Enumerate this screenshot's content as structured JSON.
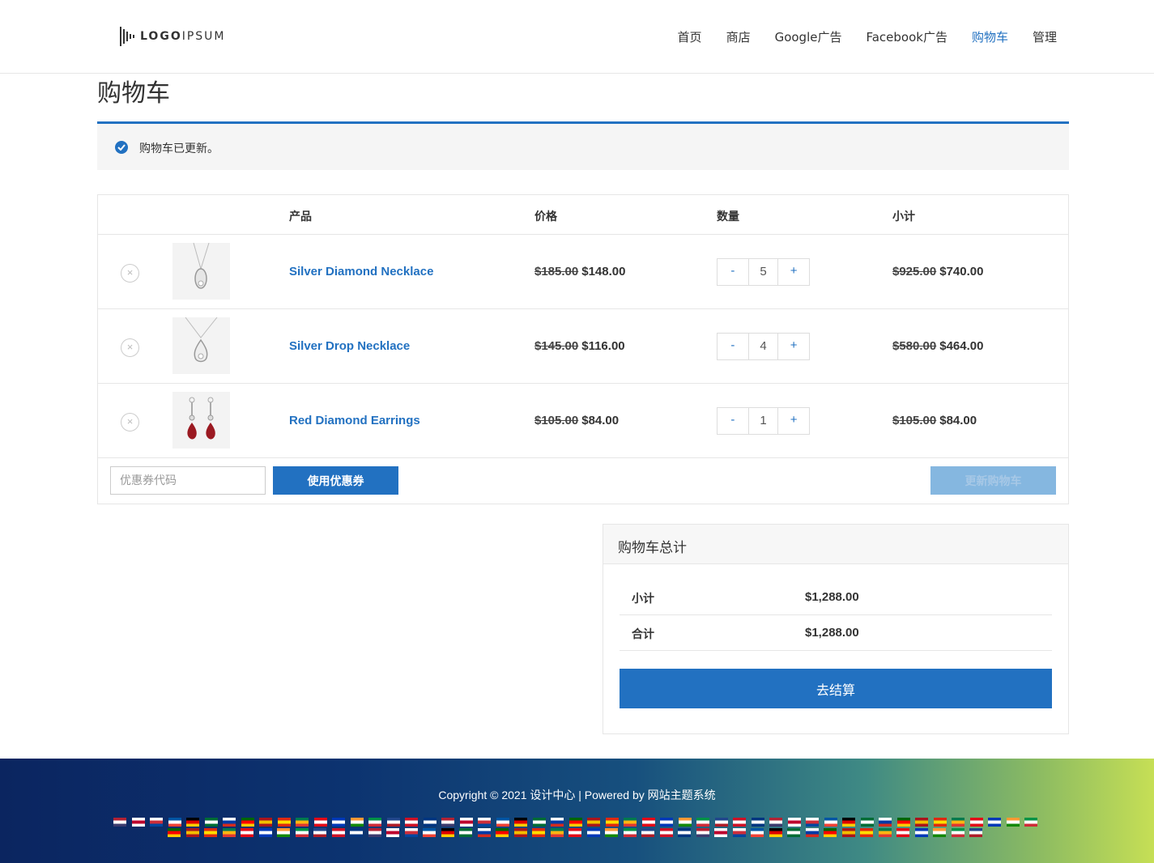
{
  "header": {
    "logo": {
      "bold": "LOGO",
      "light": "IPSUM"
    },
    "nav": [
      "首页",
      "商店",
      "Google广告",
      "Facebook广告",
      "购物车",
      "管理"
    ],
    "active_nav": "购物车"
  },
  "page_title": "购物车",
  "notice": {
    "message": "购物车已更新。"
  },
  "cart": {
    "columns": {
      "product": "产品",
      "price": "价格",
      "quantity": "数量",
      "subtotal": "小计"
    },
    "items": [
      {
        "name": "Silver Diamond Necklace",
        "old_price": "$185.00",
        "price": "$148.00",
        "qty": "5",
        "old_subtotal": "$925.00",
        "subtotal": "$740.00",
        "remove": "×",
        "minus": "-",
        "plus": "+"
      },
      {
        "name": "Silver Drop Necklace",
        "old_price": "$145.00",
        "price": "$116.00",
        "qty": "4",
        "old_subtotal": "$580.00",
        "subtotal": "$464.00",
        "remove": "×",
        "minus": "-",
        "plus": "+"
      },
      {
        "name": "Red Diamond Earrings",
        "old_price": "$105.00",
        "price": "$84.00",
        "qty": "1",
        "old_subtotal": "$105.00",
        "subtotal": "$84.00",
        "remove": "×",
        "minus": "-",
        "plus": "+"
      }
    ],
    "coupon_placeholder": "优惠券代码",
    "apply_coupon": "使用优惠券",
    "update_cart": "更新购物车"
  },
  "totals": {
    "title": "购物车总计",
    "subtotal_label": "小计",
    "subtotal_value": "$1,288.00",
    "total_label": "合计",
    "total_value": "$1,288.00",
    "checkout": "去结算"
  },
  "footer": {
    "copyright": "Copyright © 2021 设计中心 | Powered by",
    "powered_link": "网站主题系统"
  },
  "colors": {
    "accent": "#2271c1",
    "update_disabled": "#85b7e0"
  }
}
